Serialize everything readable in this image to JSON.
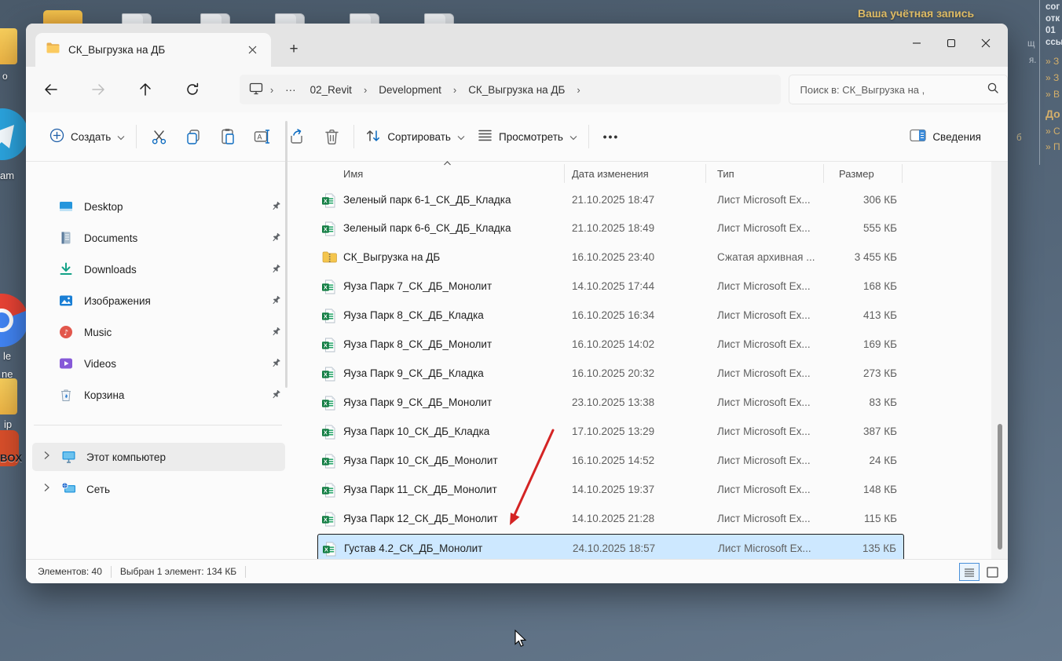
{
  "desktop": {
    "account_label": "Ваша учётная запись",
    "left_labels": {
      "l1": "o",
      "l2": "am",
      "l3": "le",
      "l4": "ne",
      "l5": "ip",
      "l6": "BOX"
    },
    "right_panel": {
      "line1": "сог",
      "line2": "отк",
      "line3": "01",
      "line4": "ссы",
      "link1": "» З",
      "link2": "» З",
      "link3": "» В",
      "heading": "До",
      "link4": "» С",
      "link5": "» П",
      "frag1": "щ",
      "frag2": "я.",
      "frag3": "б"
    }
  },
  "window": {
    "tab_title": "СК_Выгрузка на ДБ",
    "new_tab_label": "+",
    "breadcrumb": {
      "ellipsis": "···",
      "items": [
        "02_Revit",
        "Development",
        "СК_Выгрузка на ДБ"
      ]
    },
    "search": {
      "placeholder": "Поиск в: СК_Выгрузка на ,"
    },
    "toolbar": {
      "new_label": "Создать",
      "sort_label": "Сортировать",
      "view_label": "Просмотреть",
      "more_label": "•••",
      "details_label": "Сведения"
    },
    "sidebar": {
      "pinned": [
        {
          "label": "Desktop",
          "icon": "desktop"
        },
        {
          "label": "Documents",
          "icon": "documents"
        },
        {
          "label": "Downloads",
          "icon": "downloads"
        },
        {
          "label": "Изображения",
          "icon": "pictures"
        },
        {
          "label": "Music",
          "icon": "music"
        },
        {
          "label": "Videos",
          "icon": "videos"
        },
        {
          "label": "Корзина",
          "icon": "recycle"
        }
      ],
      "tree": [
        {
          "label": "Этот компьютер",
          "icon": "pc",
          "selected": true
        },
        {
          "label": "Сеть",
          "icon": "network",
          "selected": false
        }
      ]
    },
    "columns": [
      "Имя",
      "Дата изменения",
      "Тип",
      "Размер"
    ],
    "files": [
      {
        "name": "Зеленый парк 6-1_СК_ДБ_Кладка",
        "date": "21.10.2025 18:47",
        "type": "Лист Microsoft Ex...",
        "size": "306 КБ",
        "icon": "excel",
        "selected": false
      },
      {
        "name": "Зеленый парк 6-6_СК_ДБ_Кладка",
        "date": "21.10.2025 18:49",
        "type": "Лист Microsoft Ex...",
        "size": "555 КБ",
        "icon": "excel",
        "selected": false
      },
      {
        "name": "СК_Выгрузка на ДБ",
        "date": "16.10.2025 23:40",
        "type": "Сжатая архивная ...",
        "size": "3 455 КБ",
        "icon": "zip",
        "selected": false
      },
      {
        "name": "Яуза Парк 7_СК_ДБ_Монолит",
        "date": "14.10.2025 17:44",
        "type": "Лист Microsoft Ex...",
        "size": "168 КБ",
        "icon": "excel",
        "selected": false
      },
      {
        "name": "Яуза Парк 8_СК_ДБ_Кладка",
        "date": "16.10.2025 16:34",
        "type": "Лист Microsoft Ex...",
        "size": "413 КБ",
        "icon": "excel",
        "selected": false
      },
      {
        "name": "Яуза Парк 8_СК_ДБ_Монолит",
        "date": "16.10.2025 14:02",
        "type": "Лист Microsoft Ex...",
        "size": "169 КБ",
        "icon": "excel",
        "selected": false
      },
      {
        "name": "Яуза Парк 9_СК_ДБ_Кладка",
        "date": "16.10.2025 20:32",
        "type": "Лист Microsoft Ex...",
        "size": "273 КБ",
        "icon": "excel",
        "selected": false
      },
      {
        "name": "Яуза Парк 9_СК_ДБ_Монолит",
        "date": "23.10.2025 13:38",
        "type": "Лист Microsoft Ex...",
        "size": "83 КБ",
        "icon": "excel",
        "selected": false
      },
      {
        "name": "Яуза Парк 10_СК_ДБ_Кладка",
        "date": "17.10.2025 13:29",
        "type": "Лист Microsoft Ex...",
        "size": "387 КБ",
        "icon": "excel",
        "selected": false
      },
      {
        "name": "Яуза Парк 10_СК_ДБ_Монолит",
        "date": "16.10.2025 14:52",
        "type": "Лист Microsoft Ex...",
        "size": "24 КБ",
        "icon": "excel",
        "selected": false
      },
      {
        "name": "Яуза Парк 11_СК_ДБ_Монолит",
        "date": "14.10.2025 19:37",
        "type": "Лист Microsoft Ex...",
        "size": "148 КБ",
        "icon": "excel",
        "selected": false
      },
      {
        "name": "Яуза Парк 12_СК_ДБ_Монолит",
        "date": "14.10.2025 21:28",
        "type": "Лист Microsoft Ex...",
        "size": "115 КБ",
        "icon": "excel",
        "selected": false
      },
      {
        "name": "Густав 4.2_СК_ДБ_Монолит",
        "date": "24.10.2025 18:57",
        "type": "Лист Microsoft Ex...",
        "size": "135 КБ",
        "icon": "excel",
        "selected": true
      }
    ],
    "status": {
      "items_count": "Элементов: 40",
      "selection": "Выбран 1 элемент: 134 КБ"
    }
  }
}
